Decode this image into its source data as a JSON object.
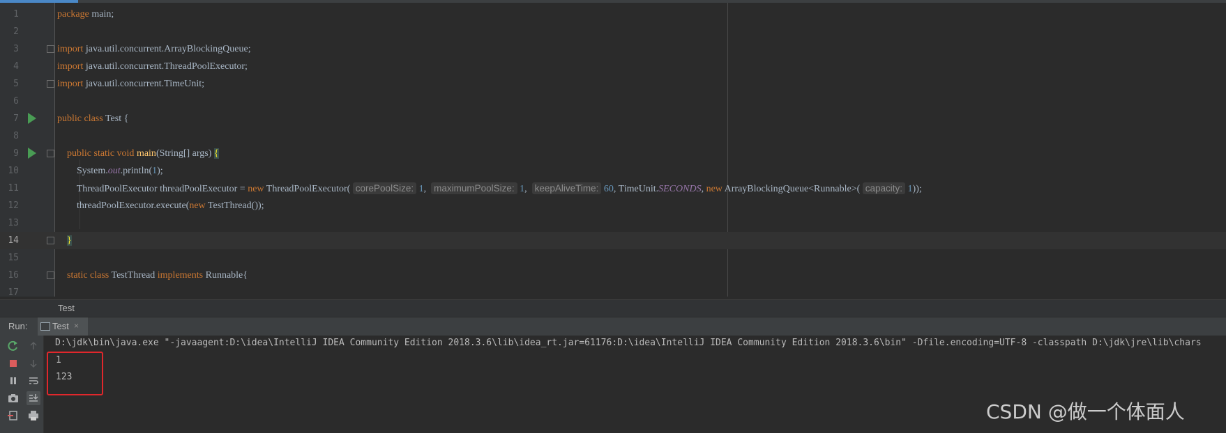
{
  "editor": {
    "lines": [
      {
        "n": "1"
      },
      {
        "n": "2"
      },
      {
        "n": "3"
      },
      {
        "n": "4"
      },
      {
        "n": "5"
      },
      {
        "n": "6"
      },
      {
        "n": "7"
      },
      {
        "n": "8"
      },
      {
        "n": "9"
      },
      {
        "n": "10"
      },
      {
        "n": "11"
      },
      {
        "n": "12"
      },
      {
        "n": "13"
      },
      {
        "n": "14"
      },
      {
        "n": "15"
      },
      {
        "n": "16"
      },
      {
        "n": "17"
      }
    ],
    "current_line": "14",
    "breadcrumb": "Test"
  },
  "run_panel": {
    "label": "Run:",
    "tab_label": "Test",
    "tab_close": "×",
    "command": "D:\\jdk\\bin\\java.exe \"-javaagent:D:\\idea\\IntelliJ IDEA Community Edition 2018.3.6\\lib\\idea_rt.jar=61176:D:\\idea\\IntelliJ IDEA Community Edition 2018.3.6\\bin\" -Dfile.encoding=UTF-8 -classpath D:\\jdk\\jre\\lib\\chars",
    "output": [
      "1",
      "123"
    ]
  },
  "watermark": "CSDN @做一个体面人",
  "icons": [
    "run-gutter-icon",
    "fold-icon",
    "rerun-icon",
    "stop-icon",
    "pause-icon",
    "camera-icon",
    "exit-icon",
    "arrow-up-icon",
    "arrow-down-icon",
    "soft-wrap-icon",
    "scroll-to-end-icon",
    "print-icon"
  ]
}
